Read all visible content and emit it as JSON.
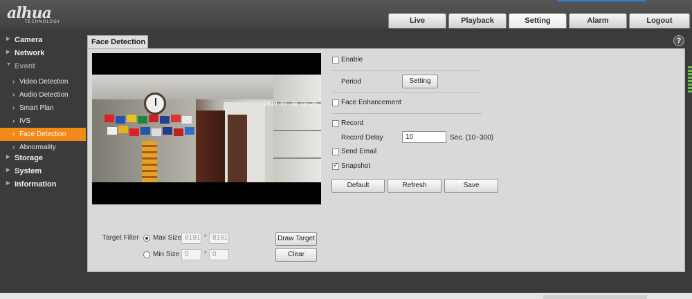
{
  "header": {
    "tabs": [
      {
        "label": "Live"
      },
      {
        "label": "Playback"
      },
      {
        "label": "Setting",
        "active": true
      },
      {
        "label": "Alarm"
      },
      {
        "label": "Logout"
      }
    ]
  },
  "sidebar": {
    "items": [
      {
        "label": "Camera",
        "level": 0
      },
      {
        "label": "Network",
        "level": 0
      },
      {
        "label": "Event",
        "level": 0,
        "expanded": true
      },
      {
        "label": "Video Detection",
        "level": 1
      },
      {
        "label": "Audio Detection",
        "level": 1
      },
      {
        "label": "Smart Plan",
        "level": 1
      },
      {
        "label": "IVS",
        "level": 1
      },
      {
        "label": "Face Detection",
        "level": 1,
        "active": true
      },
      {
        "label": "Abnormality",
        "level": 1
      },
      {
        "label": "Storage",
        "level": 0
      },
      {
        "label": "System",
        "level": 0
      },
      {
        "label": "Information",
        "level": 0
      }
    ]
  },
  "panel": {
    "title": "Face Detection",
    "help_icon": "?"
  },
  "video": {
    "timestamp": "2019-09-30 10:29"
  },
  "target_filter": {
    "label": "Target Filter",
    "max_size_label": "Max Size",
    "max_w": "8191",
    "max_h": "8191",
    "min_size_label": "Min Size",
    "min_w": "0",
    "min_h": "0",
    "times": "*",
    "selected": "max",
    "draw_target": "Draw Target",
    "clear": "Clear"
  },
  "form": {
    "enable_label": "Enable",
    "enable_checked": false,
    "period_label": "Period",
    "period_button": "Setting",
    "face_enhancement_label": "Face Enhancement",
    "face_enhancement_checked": false,
    "record_label": "Record",
    "record_checked": false,
    "record_delay_label": "Record Delay",
    "record_delay_value": "10",
    "record_delay_unit": "Sec. (10~300)",
    "send_email_label": "Send Email",
    "send_email_checked": false,
    "snapshot_label": "Snapshot",
    "snapshot_checked": true,
    "default_button": "Default",
    "refresh_button": "Refresh",
    "save_button": "Save"
  }
}
